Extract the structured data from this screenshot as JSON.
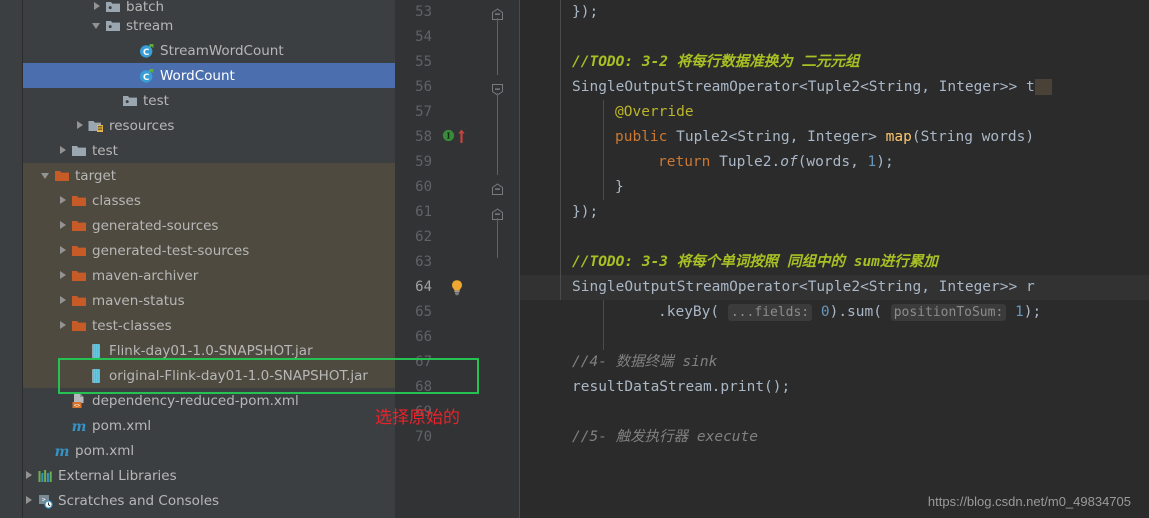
{
  "project_tree": {
    "items": [
      {
        "label": "batch",
        "indent": 4,
        "arrow": "right",
        "icon": "package-folder-icon",
        "state": "normal",
        "clipped": true
      },
      {
        "label": "stream",
        "indent": 4,
        "arrow": "down",
        "icon": "package-folder-icon",
        "state": "normal"
      },
      {
        "label": "StreamWordCount",
        "indent": 6,
        "arrow": "none",
        "icon": "java-class-runnable-icon",
        "state": "normal"
      },
      {
        "label": "WordCount",
        "indent": 6,
        "arrow": "none",
        "icon": "java-class-runnable-icon",
        "state": "selected"
      },
      {
        "label": "test",
        "indent": 5,
        "arrow": "none",
        "icon": "package-folder-icon",
        "state": "normal"
      },
      {
        "label": "resources",
        "indent": 3,
        "arrow": "right",
        "icon": "resources-folder-icon",
        "state": "normal"
      },
      {
        "label": "test",
        "indent": 2,
        "arrow": "right",
        "icon": "folder-icon",
        "state": "normal"
      },
      {
        "label": "target",
        "indent": 1,
        "arrow": "down",
        "icon": "excluded-folder-icon",
        "state": "excluded"
      },
      {
        "label": "classes",
        "indent": 2,
        "arrow": "right",
        "icon": "excluded-folder-icon",
        "state": "excluded"
      },
      {
        "label": "generated-sources",
        "indent": 2,
        "arrow": "right",
        "icon": "excluded-folder-icon",
        "state": "excluded"
      },
      {
        "label": "generated-test-sources",
        "indent": 2,
        "arrow": "right",
        "icon": "excluded-folder-icon",
        "state": "excluded"
      },
      {
        "label": "maven-archiver",
        "indent": 2,
        "arrow": "right",
        "icon": "excluded-folder-icon",
        "state": "excluded"
      },
      {
        "label": "maven-status",
        "indent": 2,
        "arrow": "right",
        "icon": "excluded-folder-icon",
        "state": "excluded"
      },
      {
        "label": "test-classes",
        "indent": 2,
        "arrow": "right",
        "icon": "excluded-folder-icon",
        "state": "excluded"
      },
      {
        "label": "Flink-day01-1.0-SNAPSHOT.jar",
        "indent": 3,
        "arrow": "none",
        "icon": "jar-file-icon",
        "state": "excluded"
      },
      {
        "label": "original-Flink-day01-1.0-SNAPSHOT.jar",
        "indent": 3,
        "arrow": "none",
        "icon": "jar-file-icon",
        "state": "excluded",
        "highlighted": true
      },
      {
        "label": "dependency-reduced-pom.xml",
        "indent": 2,
        "arrow": "none",
        "icon": "xml-file-icon",
        "state": "normal"
      },
      {
        "label": "pom.xml",
        "indent": 2,
        "arrow": "none",
        "icon": "maven-pom-icon",
        "state": "normal"
      },
      {
        "label": "pom.xml",
        "indent": 1,
        "arrow": "none",
        "icon": "maven-pom-icon",
        "state": "normal"
      },
      {
        "label": "External Libraries",
        "indent": 0,
        "arrow": "right",
        "icon": "libraries-icon",
        "state": "normal"
      },
      {
        "label": "Scratches and Consoles",
        "indent": 0,
        "arrow": "right",
        "icon": "scratches-icon",
        "state": "normal"
      }
    ]
  },
  "editor": {
    "first_line": 53,
    "last_line": 70,
    "line_numbers": [
      "53",
      "54",
      "55",
      "56",
      "57",
      "58",
      "59",
      "60",
      "61",
      "62",
      "63",
      "64",
      "65",
      "66",
      "67",
      "68",
      "69",
      "70"
    ],
    "current_line": 64,
    "gutter_markers": [
      {
        "line": 58,
        "icon": "implementing-method-icon"
      },
      {
        "line": 58,
        "icon": "overriding-arrow-icon"
      },
      {
        "line": 64,
        "icon": "intention-bulb-icon"
      }
    ],
    "code_lines": {
      "l53": "});",
      "l54": "",
      "l55_comment": "//TODO: 3-2 将每行数据准换为 二元元组",
      "l56_a": "SingleOutputStreamOperator<Tuple2<String, Integer>> t",
      "l57_annotation": "@Override",
      "l58_mod": "public",
      "l58_sig": " Tuple2<String, Integer> ",
      "l58_meth": "map",
      "l58_args": "(String words)",
      "l59_kw": "return",
      "l59_a": " Tuple2.",
      "l59_of": "of",
      "l59_b": "(words, ",
      "l59_num": "1",
      "l59_c": ");",
      "l60": "}",
      "l61": "});",
      "l62": "",
      "l63_comment": "//TODO: 3-3 将每个单词按照 同组中的 sum进行累加",
      "l64_a": "SingleOutputStreamOperator<Tuple2<String, Integer>> r",
      "l65_a": ".keyBy(",
      "l65_hint1": "...fields:",
      "l65_num1": "0",
      "l65_b": ").sum(",
      "l65_hint2": "positionToSum:",
      "l65_num2": "1",
      "l65_c": ");",
      "l66": "",
      "l67_comment": "//4- 数据终端 sink",
      "l68": "resultDataStream.print();",
      "l69": "",
      "l70_comment": "//5- 触发执行器 execute"
    }
  },
  "annotations": {
    "red_note": "选择原始的",
    "green_highlight_target": "original-Flink-day01-1.0-SNAPSHOT.jar",
    "green_color": "#26c153",
    "red_color": "#e8232c"
  },
  "watermark": {
    "url": "https://blog.csdn.net/m0_49834705"
  }
}
